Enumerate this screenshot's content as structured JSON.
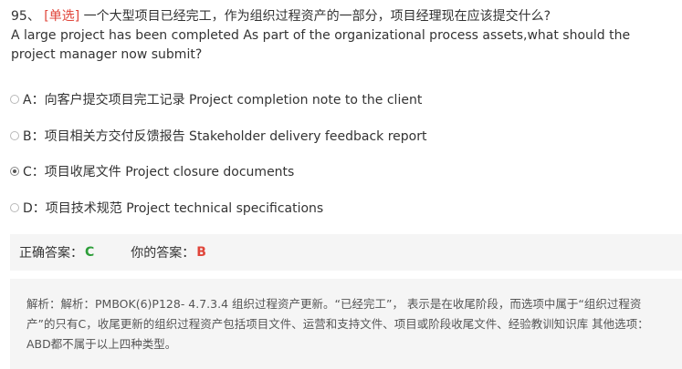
{
  "question": {
    "number": "95、",
    "type": "[单选]",
    "text_zh": "一个大型项目已经完工，作为组织过程资产的一部分，项目经理现在应该提交什么?",
    "text_en": "A large project has been completed As part of the organizational process assets,what should the project manager now submit?"
  },
  "options": [
    {
      "label": "A：向客户提交项目完工记录 Project completion note to the client",
      "checked": false
    },
    {
      "label": "B：项目相关方交付反馈报告 Stakeholder delivery feedback report",
      "checked": false
    },
    {
      "label": "C：项目收尾文件 Project closure documents",
      "checked": true
    },
    {
      "label": "D：项目技术规范 Project technical specifications",
      "checked": false
    }
  ],
  "answer": {
    "correct_label": "正确答案：",
    "correct_value": "C",
    "yours_label": "你的答案：",
    "yours_value": "B",
    "correct_color": "#2e9e3a",
    "yours_color": "#e0453a"
  },
  "analysis": {
    "text": "解析：解析：PMBOK(6)P128- 4.7.3.4 组织过程资产更新。“已经完工”， 表示是在收尾阶段，而选项中属于“组织过程资产”的只有C，收尾更新的组织过程资产包括项目文件、运营和支持文件、项目或阶段收尾文件、经验教训知识库 其他选项：ABD都不属于以上四种类型。"
  }
}
